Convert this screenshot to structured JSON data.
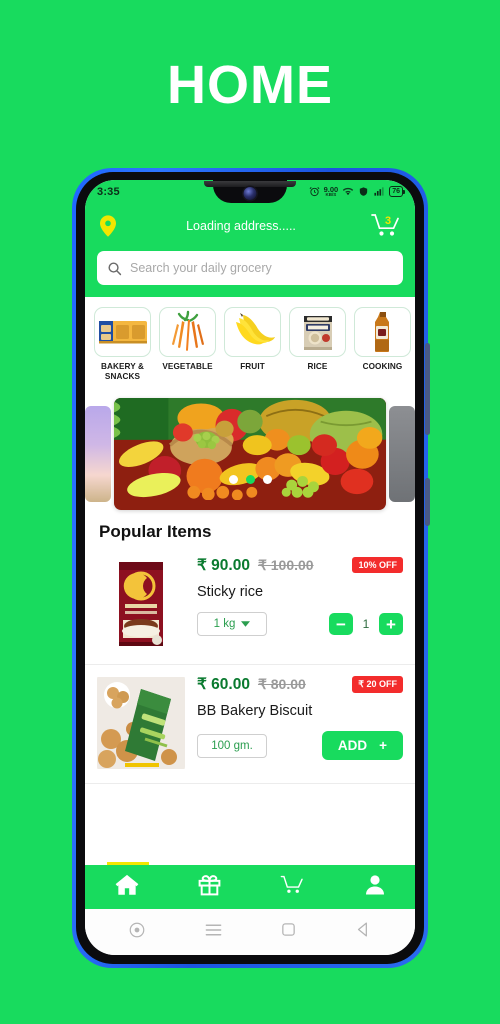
{
  "page": {
    "title": "HOME"
  },
  "statusbar": {
    "time": "3:35",
    "data_rate_value": "9.00",
    "data_rate_unit": "KB/S",
    "battery_percent": "76",
    "icons": [
      "alarm-icon",
      "data-rate-icon",
      "wifi-icon",
      "vpn-icon",
      "signal-icon",
      "battery-icon"
    ]
  },
  "header": {
    "address": "Loading address.....",
    "cart_count": "3",
    "location_icon": "location-pin-icon",
    "cart_icon": "shopping-cart-icon"
  },
  "search": {
    "placeholder": "Search your daily grocery",
    "value": "",
    "icon": "search-icon"
  },
  "categories": [
    {
      "label": "BAKERY & SNACKS",
      "icon": "bakery-snacks-icon"
    },
    {
      "label": "VEGETABLE",
      "icon": "vegetable-icon"
    },
    {
      "label": "FRUIT",
      "icon": "fruit-icon"
    },
    {
      "label": "RICE",
      "icon": "rice-icon"
    },
    {
      "label": "COOKING",
      "icon": "cooking-oil-icon"
    }
  ],
  "carousel": {
    "slide_count": 3,
    "active_index": 1,
    "active_color": "#18DB5E",
    "inactive_color": "#FFFFFF"
  },
  "section": {
    "popular_title": "Popular Items"
  },
  "products": [
    {
      "name": "Sticky rice",
      "price": "₹ 90.00",
      "old_price": "₹ 100.00",
      "discount": "10% OFF",
      "weight": "1 kg",
      "quantity": "1",
      "control": "stepper",
      "minus_label": "−",
      "plus_label": "+"
    },
    {
      "name": "BB Bakery Biscuit",
      "price": "₹ 60.00",
      "old_price": "₹ 80.00",
      "discount": "₹ 20 OFF",
      "weight": "100 gm.",
      "control": "add",
      "add_label": "ADD",
      "add_plus": "+"
    }
  ],
  "bottom_nav": [
    {
      "name": "home",
      "icon": "home-icon",
      "active": true
    },
    {
      "name": "offers",
      "icon": "gift-icon",
      "active": false
    },
    {
      "name": "cart",
      "icon": "cart-icon",
      "active": false
    },
    {
      "name": "account",
      "icon": "person-icon",
      "active": false
    }
  ],
  "system_nav": [
    {
      "name": "assistant",
      "icon": "assistant-circle-icon"
    },
    {
      "name": "recents",
      "icon": "menu-lines-icon"
    },
    {
      "name": "home",
      "icon": "square-icon"
    },
    {
      "name": "back",
      "icon": "back-triangle-icon"
    }
  ],
  "colors": {
    "brand_green": "#18DB5E",
    "badge_red": "#F32C2C",
    "price_green": "#0A7A2F",
    "badge_yellow": "#F2E600"
  }
}
